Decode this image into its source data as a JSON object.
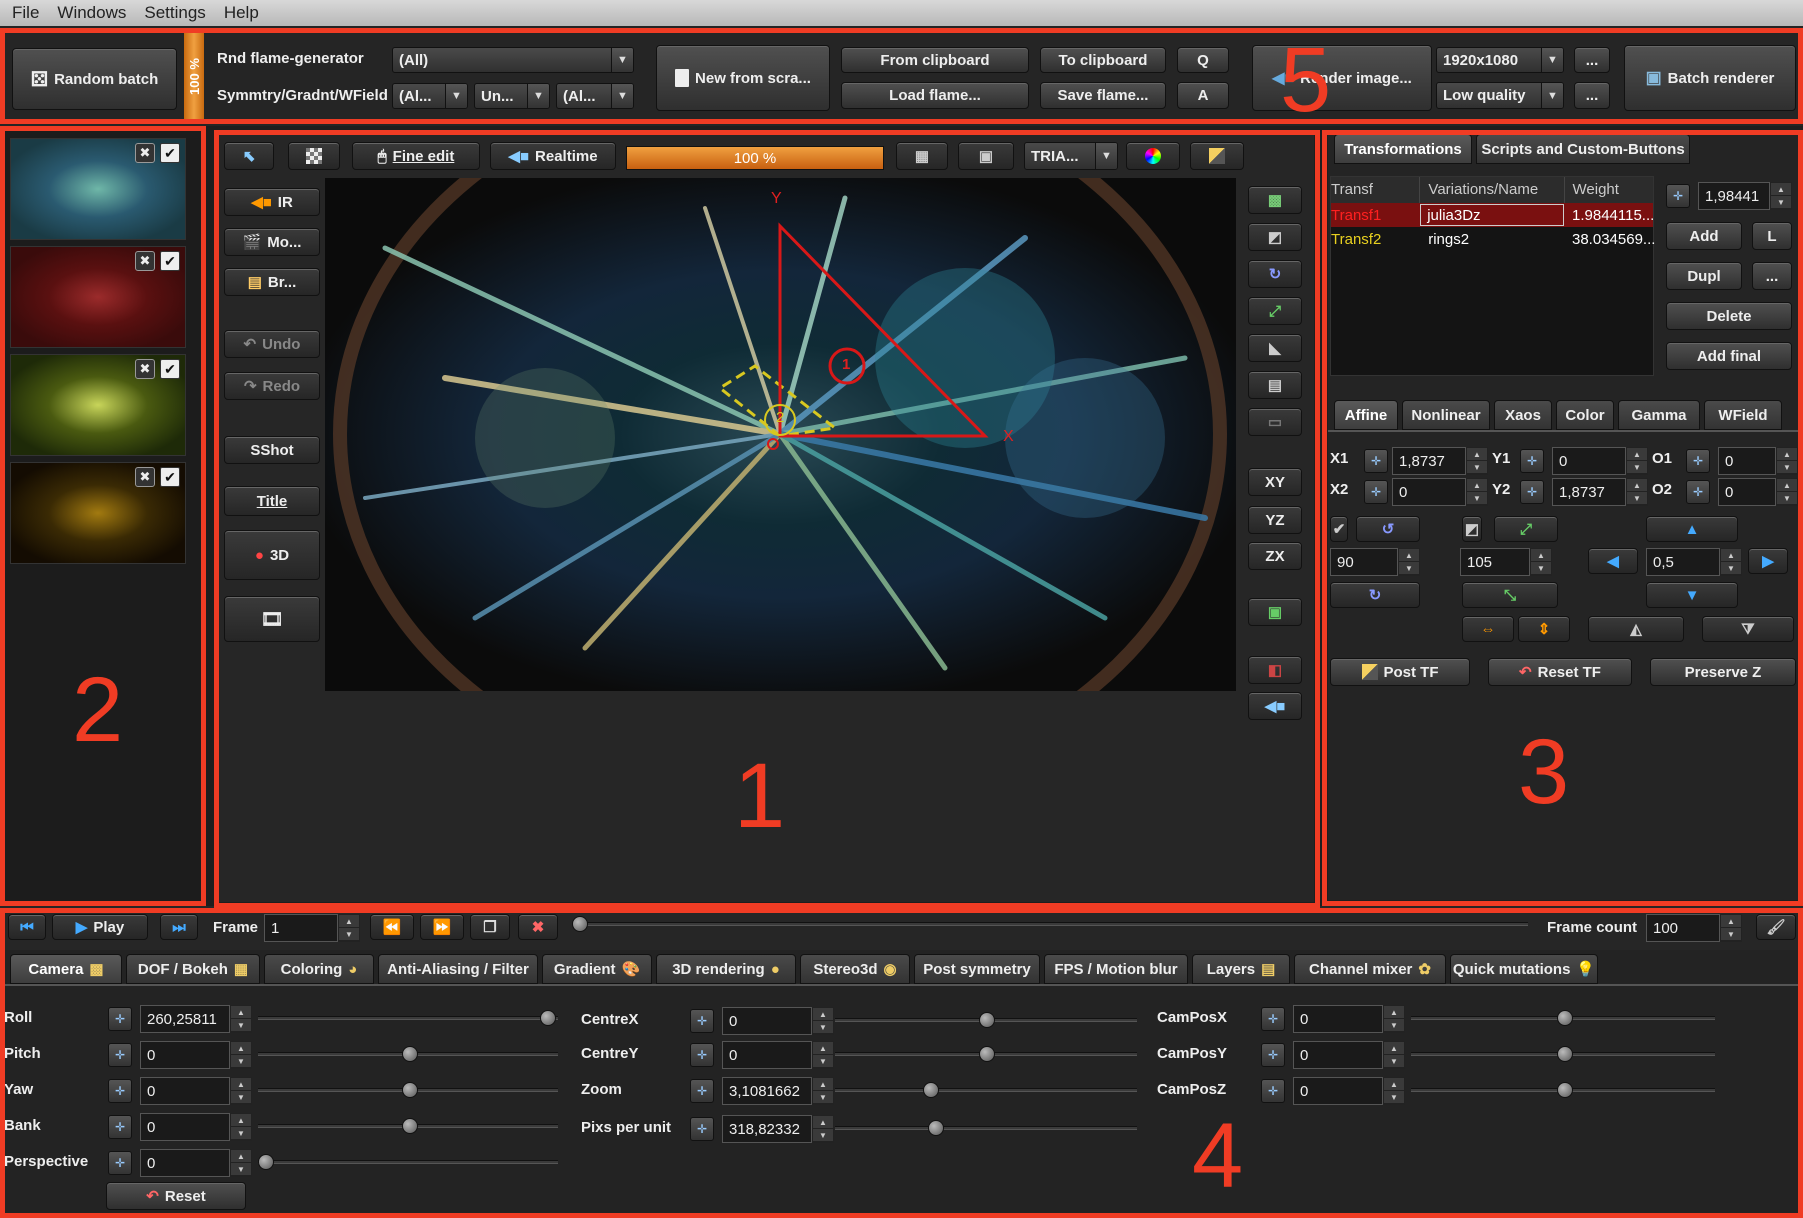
{
  "menu": [
    "File",
    "Windows",
    "Settings",
    "Help"
  ],
  "toolbar": {
    "random_batch": "Random batch",
    "batch_percent": "100 %",
    "rnd_generator_label": "Rnd flame-generator",
    "rnd_generator_value": "(All)",
    "symmetry_label": "Symmtry/Gradnt/WField",
    "symmetry_value": "(Al...",
    "gradient_value": "Un...",
    "wfield_value": "(Al...",
    "new_from_scratch": "New from scra...",
    "from_clipboard": "From clipboard",
    "load_flame": "Load flame...",
    "to_clipboard": "To clipboard",
    "save_flame": "Save flame...",
    "q_button": "Q",
    "a_button": "A",
    "render_image": "Render image...",
    "resolution": "1920x1080",
    "quality": "Low quality",
    "more": "...",
    "batch_renderer": "Batch renderer"
  },
  "thumbnails": [
    {
      "colors": [
        "#1a3b45",
        "#6fb7a8",
        "#2a5a70"
      ]
    },
    {
      "colors": [
        "#3a0b0b",
        "#9b2b2b",
        "#5a1010"
      ]
    },
    {
      "colors": [
        "#1e2a08",
        "#c8d55a",
        "#4a5a10"
      ]
    },
    {
      "colors": [
        "#140c02",
        "#a27a10",
        "#3a2a04"
      ]
    }
  ],
  "editor_toolbar": {
    "fine_edit": "Fine edit",
    "realtime": "Realtime",
    "progress": "100 %",
    "progress_value": 1.0,
    "triangle_mode": "TRIA..."
  },
  "left_tools": {
    "ir": "IR",
    "mo": "Mo...",
    "br": "Br...",
    "undo": "Undo",
    "redo": "Redo",
    "sshot": "SShot",
    "title": "Title",
    "three_d": "3D"
  },
  "axis_buttons": [
    "XY",
    "YZ",
    "ZX"
  ],
  "triangle": {
    "x_label": "X",
    "y_label": "Y",
    "t1": "1",
    "t2": "2",
    "origin": "O"
  },
  "transforms_panel": {
    "tabs": [
      "Transformations",
      "Scripts and Custom-Buttons"
    ],
    "columns": [
      "Transf",
      "Variations/Name",
      "Weight"
    ],
    "rows": [
      {
        "name": "Transf1",
        "variation": "julia3Dz",
        "weight": "1.9844115..."
      },
      {
        "name": "Transf2",
        "variation": "rings2",
        "weight": "38.034569..."
      }
    ],
    "weight_value": "1,98441",
    "add": "Add",
    "l": "L",
    "dupl": "Dupl",
    "more": "...",
    "delete": "Delete",
    "add_final": "Add final"
  },
  "affine_panel": {
    "tabs": [
      "Affine",
      "Nonlinear",
      "Xaos",
      "Color",
      "Gamma",
      "WField"
    ],
    "x1_label": "X1",
    "x1": "1,8737",
    "y1_label": "Y1",
    "y1": "0",
    "o1_label": "O1",
    "o1": "0",
    "x2_label": "X2",
    "x2": "0",
    "y2_label": "Y2",
    "y2": "1,8737",
    "o2_label": "O2",
    "o2": "0",
    "rotate_value": "90",
    "scale_value": "105",
    "move_value": "0,5",
    "post_tf": "Post TF",
    "reset_tf": "Reset TF",
    "preserve_z": "Preserve Z"
  },
  "timeline": {
    "play": "Play",
    "frame_label": "Frame",
    "frame_value": "1",
    "frame_count_label": "Frame count",
    "frame_count_value": "100"
  },
  "bottom_tabs": [
    "Camera",
    "DOF / Bokeh",
    "Coloring",
    "Anti-Aliasing / Filter",
    "Gradient",
    "3D rendering",
    "Stereo3d",
    "Post symmetry",
    "FPS / Motion blur",
    "Layers",
    "Channel mixer",
    "Quick mutations"
  ],
  "camera": {
    "roll_label": "Roll",
    "roll": "260,25811",
    "pitch_label": "Pitch",
    "pitch": "0",
    "yaw_label": "Yaw",
    "yaw": "0",
    "bank_label": "Bank",
    "bank": "0",
    "perspective_label": "Perspective",
    "perspective": "0",
    "reset": "Reset",
    "centrex_label": "CentreX",
    "centrex": "0",
    "centrey_label": "CentreY",
    "centrey": "0",
    "zoom_label": "Zoom",
    "zoom": "3,1081662",
    "pix_label": "Pixs per unit",
    "pix": "318,82332",
    "camposx_label": "CamPosX",
    "camposx": "0",
    "camposy_label": "CamPosY",
    "camposy": "0",
    "camposz_label": "CamPosZ",
    "camposz": "0"
  },
  "annotations": [
    "1",
    "2",
    "3",
    "4",
    "5"
  ],
  "colors": {
    "annotation_red": "#f03c24",
    "accent_orange": "#e0871a",
    "selected_row": "#7a1010"
  }
}
